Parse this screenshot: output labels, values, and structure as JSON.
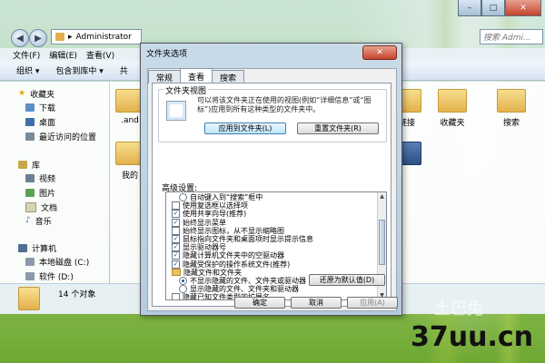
{
  "explorer": {
    "address": "Administrator",
    "search_placeholder": "搜索 Admi...",
    "menu": [
      "文件(F)",
      "编辑(E)",
      "查看(V)"
    ],
    "toolbar": [
      "组织 ▾",
      "包含到库中 ▾",
      "共"
    ],
    "sidebar": {
      "favorites": "收藏夹",
      "favorites_items": [
        "下载",
        "桌面",
        "最近访问的位置"
      ],
      "libraries": "库",
      "library_items": [
        "视频",
        "图片",
        "文档",
        "音乐"
      ],
      "computer": "计算机",
      "computer_items": [
        "本地磁盘 (C:)",
        "软件 (D:)"
      ]
    },
    "content_items": [
      ".and",
      "我的",
      "链接",
      "收藏夹",
      "搜索"
    ],
    "status": "14 个对象"
  },
  "dialog": {
    "title": "文件夹选项",
    "close": "✕",
    "tabs": [
      "常规",
      "查看",
      "搜索"
    ],
    "group_title": "文件夹视图",
    "group_desc": "可以将该文件夹正在使用的视图(例如“详细信息”或“图标”)应用到所有这种类型的文件夹中。",
    "apply_folders": "应用到文件夹(L)",
    "reset_folders": "重置文件夹(R)",
    "advanced_label": "高级设置:",
    "tree": [
      {
        "type": "radio",
        "checked": false,
        "indent": 1,
        "text": "自动键入到“搜索”框中"
      },
      {
        "type": "check",
        "checked": false,
        "indent": 0,
        "text": "使用复选框以选择项"
      },
      {
        "type": "check",
        "checked": true,
        "indent": 0,
        "text": "使用共享向导(推荐)"
      },
      {
        "type": "check",
        "checked": true,
        "indent": 0,
        "text": "始终显示菜单"
      },
      {
        "type": "check",
        "checked": false,
        "indent": 0,
        "text": "始终显示图标，从不显示缩略图"
      },
      {
        "type": "check",
        "checked": true,
        "indent": 0,
        "text": "鼠标指向文件夹和桌面项时显示提示信息"
      },
      {
        "type": "check",
        "checked": true,
        "indent": 0,
        "text": "显示驱动器号"
      },
      {
        "type": "check",
        "checked": true,
        "indent": 0,
        "text": "隐藏计算机文件夹中的空驱动器"
      },
      {
        "type": "check",
        "checked": true,
        "indent": 0,
        "text": "隐藏受保护的操作系统文件(推荐)"
      },
      {
        "type": "folder",
        "checked": false,
        "indent": 0,
        "text": "隐藏文件和文件夹"
      },
      {
        "type": "radio",
        "checked": true,
        "indent": 1,
        "text": "不显示隐藏的文件、文件夹或驱动器"
      },
      {
        "type": "radio",
        "checked": false,
        "indent": 1,
        "text": "显示隐藏的文件、文件夹和驱动器"
      },
      {
        "type": "check",
        "checked": false,
        "indent": 0,
        "text": "隐藏已知文件类型的扩展名"
      }
    ],
    "restore_defaults": "还原为默认值(D)",
    "ok": "确定",
    "cancel": "取消",
    "apply": "应用(A)"
  },
  "watermark": "37uu.cn",
  "watermark_faint": "土巴兔"
}
